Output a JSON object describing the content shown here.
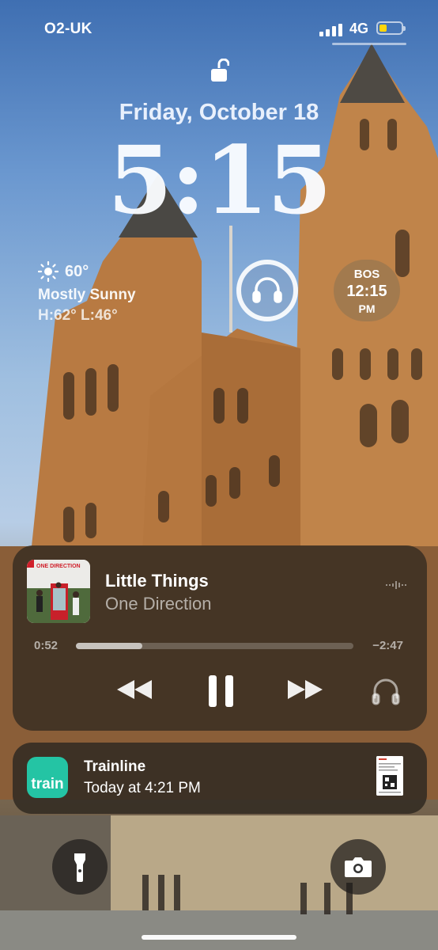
{
  "status_bar": {
    "carrier": "O2-UK",
    "network": "4G",
    "signal_bars": 4,
    "battery_level": 0.3,
    "battery_color": "#ffd60a"
  },
  "lock": {
    "icon": "lock-open-icon"
  },
  "date": "Friday, October 18",
  "time": "5:15",
  "weather": {
    "icon": "sun-icon",
    "temp": "60°",
    "condition": "Mostly Sunny",
    "high_low": "H:62° L:46°"
  },
  "headphones_widget": {
    "icon": "headphones-icon",
    "level": 1.0
  },
  "world_clock": {
    "city": "BOS",
    "time": "12:15",
    "ampm": "PM"
  },
  "now_playing": {
    "album_art_label": "ONE DIRECTION",
    "title": "Little Things",
    "artist": "One Direction",
    "elapsed": "0:52",
    "remaining": "−2:47",
    "progress": 0.24,
    "controls": [
      "rewind",
      "pause",
      "fast-forward",
      "airpods"
    ]
  },
  "notification": {
    "app_icon_text": "train",
    "app_color": "#24c4a4",
    "title": "Trainline",
    "subtitle": "Today at 4:21 PM"
  },
  "bottom_buttons": {
    "left": "flashlight-icon",
    "right": "camera-icon"
  }
}
